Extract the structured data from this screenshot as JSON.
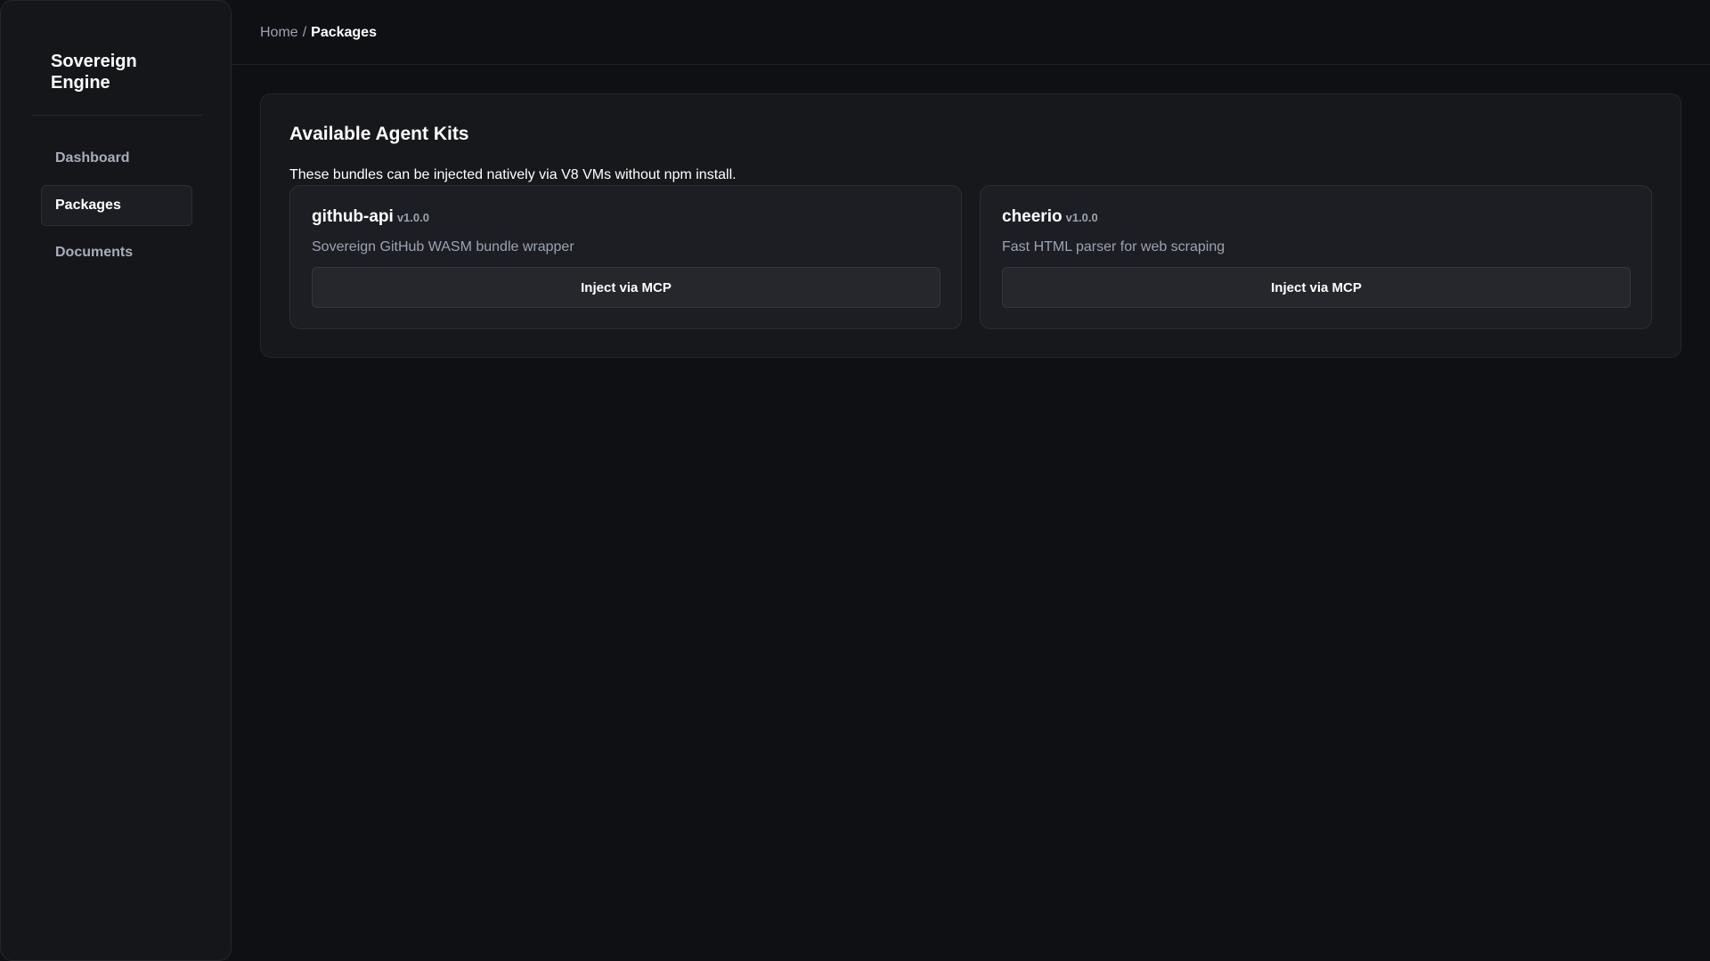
{
  "sidebar": {
    "brand": "Sovereign Engine",
    "items": [
      {
        "label": "Dashboard",
        "active": false
      },
      {
        "label": "Packages",
        "active": true
      },
      {
        "label": "Documents",
        "active": false
      }
    ]
  },
  "header": {
    "breadcrumb": {
      "home": "Home",
      "separator": "/",
      "current": "Packages"
    }
  },
  "main": {
    "title": "Available Agent Kits",
    "description": "These bundles can be injected natively via V8 VMs without npm install.",
    "packages": [
      {
        "name": "github-api",
        "version": "v1.0.0",
        "description": "Sovereign GitHub WASM bundle wrapper",
        "action": "Inject via MCP"
      },
      {
        "name": "cheerio",
        "version": "v1.0.0",
        "description": "Fast HTML parser for web scraping",
        "action": "Inject via MCP"
      }
    ]
  },
  "colors": {
    "background": "#0f1014",
    "sidebar": "#15161a",
    "panel": "#17181c",
    "card": "#1d1e23",
    "button": "#26272d",
    "muted_text": "#9aa3b2"
  }
}
